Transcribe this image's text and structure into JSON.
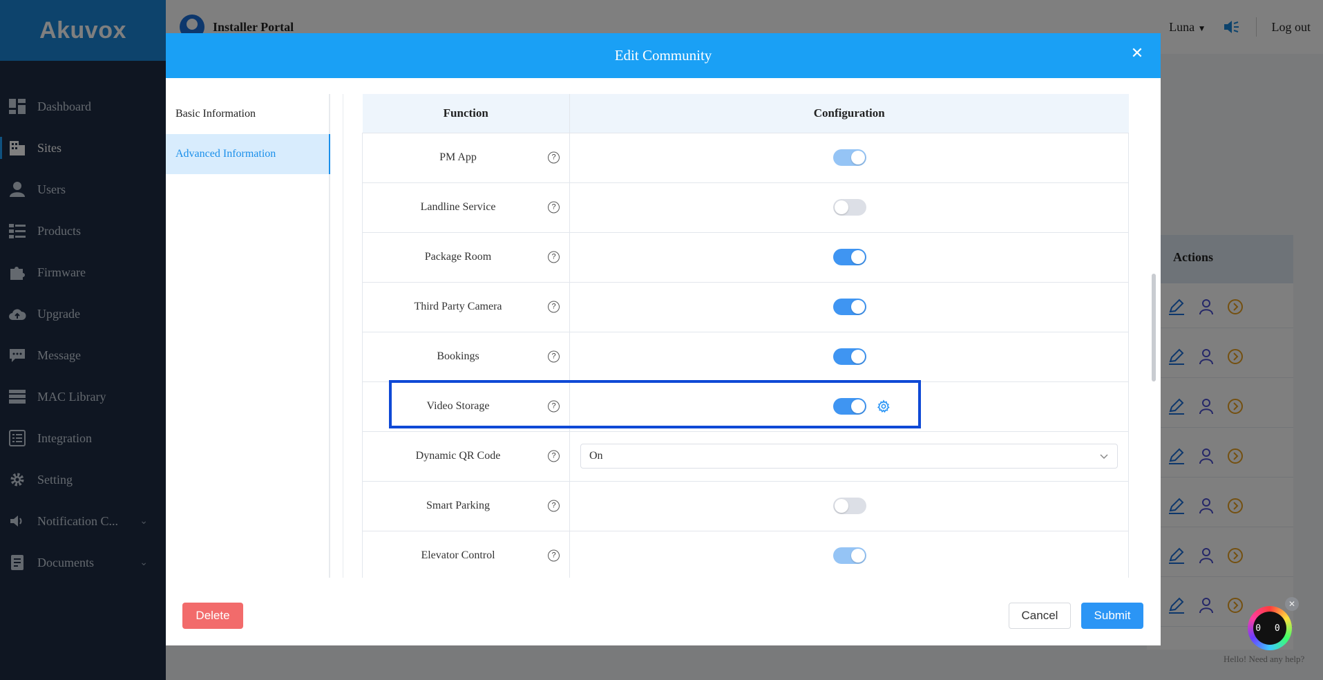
{
  "brand": {
    "logo_text": "Akuvox"
  },
  "topbar": {
    "portal_title": "Installer Portal",
    "user_name": "Luna",
    "logout_label": "Log out"
  },
  "sidebar": {
    "items": [
      {
        "label": "Dashboard",
        "icon": "dashboard-icon"
      },
      {
        "label": "Sites",
        "icon": "building-icon",
        "active": true
      },
      {
        "label": "Users",
        "icon": "user-icon"
      },
      {
        "label": "Products",
        "icon": "list-icon"
      },
      {
        "label": "Firmware",
        "icon": "puzzle-icon"
      },
      {
        "label": "Upgrade",
        "icon": "cloud-upload-icon"
      },
      {
        "label": "Message",
        "icon": "chat-icon"
      },
      {
        "label": "MAC Library",
        "icon": "server-icon"
      },
      {
        "label": "Integration",
        "icon": "doc-list-icon"
      },
      {
        "label": "Setting",
        "icon": "gear-icon"
      },
      {
        "label": "Notification C...",
        "icon": "speaker-icon",
        "expandable": true
      },
      {
        "label": "Documents",
        "icon": "document-icon",
        "expandable": true
      }
    ]
  },
  "background_table": {
    "actions_header": "Actions"
  },
  "modal": {
    "title": "Edit Community",
    "tabs": [
      {
        "label": "Basic Information",
        "active": false
      },
      {
        "label": "Advanced Information",
        "active": true
      }
    ],
    "table": {
      "headers": {
        "function": "Function",
        "configuration": "Configuration"
      },
      "rows": [
        {
          "function": "PM App",
          "type": "toggle",
          "state": "on",
          "disabled": true
        },
        {
          "function": "Landline Service",
          "type": "toggle",
          "state": "off",
          "disabled": true
        },
        {
          "function": "Package Room",
          "type": "toggle",
          "state": "on"
        },
        {
          "function": "Third Party Camera",
          "type": "toggle",
          "state": "on"
        },
        {
          "function": "Bookings",
          "type": "toggle",
          "state": "on"
        },
        {
          "function": "Video Storage",
          "type": "toggle",
          "state": "on",
          "has_settings": true,
          "highlighted": true
        },
        {
          "function": "Dynamic QR Code",
          "type": "select",
          "value": "On"
        },
        {
          "function": "Smart Parking",
          "type": "toggle",
          "state": "off",
          "disabled": true
        },
        {
          "function": "Elevator Control",
          "type": "toggle",
          "state": "on",
          "disabled": true
        }
      ]
    },
    "buttons": {
      "delete": "Delete",
      "cancel": "Cancel",
      "submit": "Submit"
    }
  },
  "help_bot": {
    "text": "Hello! Need any help?",
    "face": "0 0"
  },
  "colors": {
    "header_blue": "#1aa0f5",
    "toggle_on": "#3f95f2",
    "delete_red": "#f26b6b",
    "highlight": "#0f49d6"
  }
}
